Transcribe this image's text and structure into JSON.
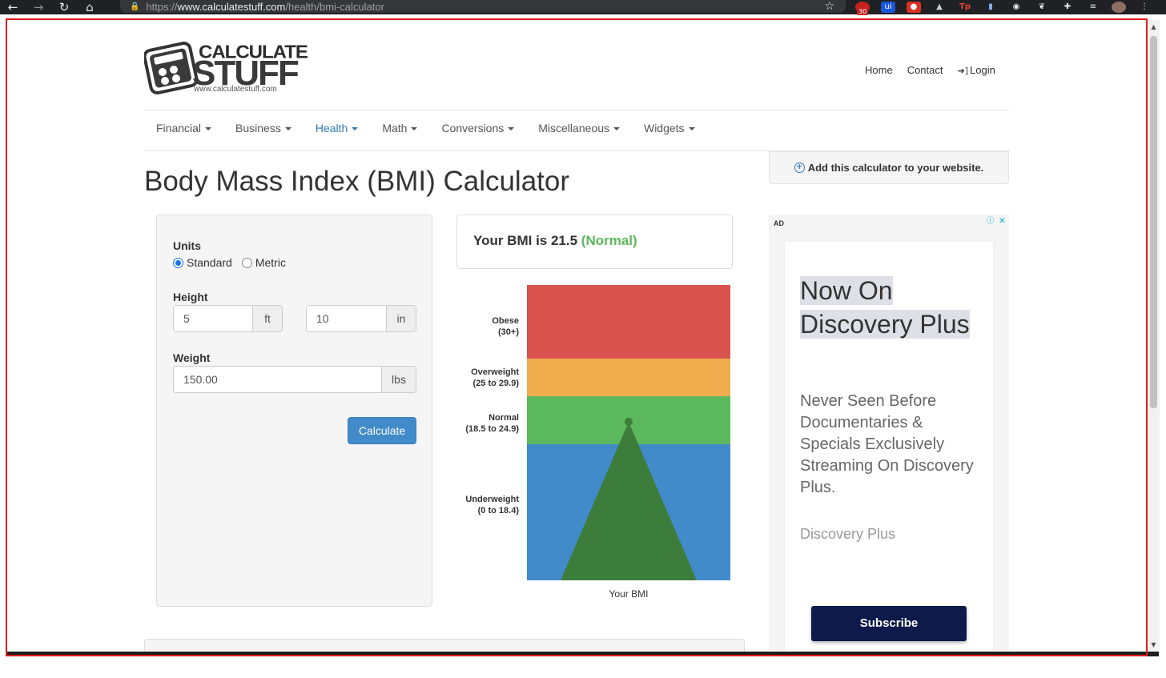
{
  "browser": {
    "url_scheme": "https://",
    "url_host": "www.calculatestuff.com",
    "url_path": "/health/bmi-calculator",
    "badge_count": "30"
  },
  "header": {
    "logo_line1": "CALCULATE",
    "logo_line2": "STUFF",
    "logo_url": "www.calculatestuff.com",
    "links": {
      "home": "Home",
      "contact": "Contact",
      "login": "Login"
    }
  },
  "menu": {
    "items": [
      "Financial",
      "Business",
      "Health",
      "Math",
      "Conversions",
      "Miscellaneous",
      "Widgets"
    ],
    "active": "Health"
  },
  "page_title": "Body Mass Index (BMI) Calculator",
  "form": {
    "units_label": "Units",
    "unit_standard": "Standard",
    "unit_metric": "Metric",
    "selected_unit": "Standard",
    "height_label": "Height",
    "height_ft": "5",
    "height_ft_unit": "ft",
    "height_in": "10",
    "height_in_unit": "in",
    "weight_label": "Weight",
    "weight": "150.00",
    "weight_unit": "lbs",
    "calculate": "Calculate"
  },
  "result": {
    "prefix": "Your BMI is 21.5",
    "status": "(Normal)",
    "bmi": 21.5,
    "status_color": "#5cb85c"
  },
  "chart_data": {
    "type": "bar",
    "xlabel": "Your BMI",
    "bands": [
      {
        "name": "Obese",
        "range": "(30+)",
        "color": "#d9534f"
      },
      {
        "name": "Overweight",
        "range": "(25 to 29.9)",
        "color": "#f0ad4e"
      },
      {
        "name": "Normal",
        "range": "(18.5 to 24.9)",
        "color": "#5cb85c"
      },
      {
        "name": "Underweight",
        "range": "(0 to 18.4)",
        "color": "#428bca"
      }
    ],
    "indicator_color": "#3c7d3c",
    "value": 21.5
  },
  "sidebar": {
    "add_widget": "Add this calculator to your website."
  },
  "ad": {
    "tag": "AD",
    "headline": "Now On Discovery Plus",
    "body": "Never Seen Before Documentaries & Specials Exclusively Streaming On Discovery Plus.",
    "brand": "Discovery Plus",
    "cta": "Subscribe"
  }
}
